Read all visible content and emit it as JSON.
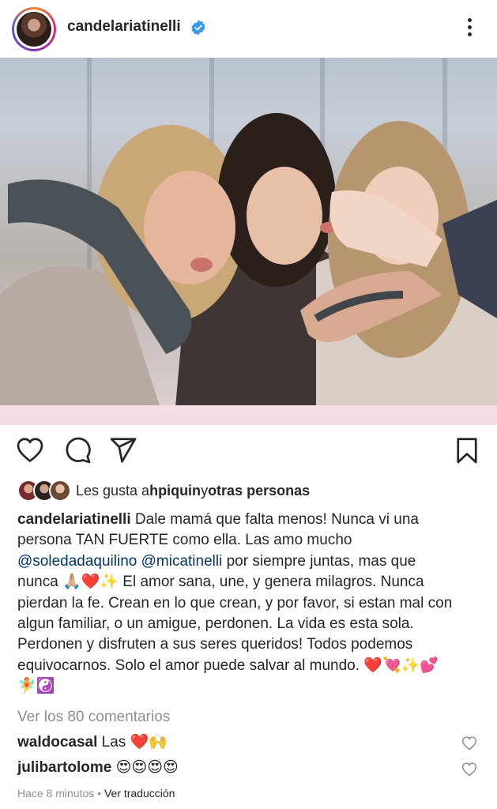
{
  "header": {
    "username": "candelariatinelli"
  },
  "likes": {
    "prefix": "Les gusta a ",
    "user": "hpiquin",
    "connector": " y ",
    "others": "otras personas"
  },
  "caption": {
    "username": "candelariatinelli",
    "line1": " Dale mamá que falta menos! Nunca vi una",
    "line2": "persona TAN FUERTE como ella. Las amo mucho",
    "mention1": "@soledadaquilino",
    "mention2": "@micatinelli",
    "line3_rest": " por siempre juntas, mas que",
    "line4a": "nunca 🙏🏼❤️✨ El amor sana, une, y genera milagros. Nunca",
    "line5": "pierdan la fe. Crean en lo que crean, y por favor, si estan mal con",
    "line6": "algun familiar, o un amigue, perdonen. La vida es esta sola.",
    "line7": "Perdonen y disfruten a sus seres queridos! Todos podemos",
    "line8": "equivocarnos. Solo el amor puede salvar al mundo. ❤️💘✨💕",
    "line9": "🧚☯️"
  },
  "comments_link": "Ver los 80 comentarios",
  "comments": [
    {
      "user": "waldocasal",
      "text": " Las ❤️🙌"
    },
    {
      "user": "julibartolome",
      "text": " 😍😍😍😍"
    }
  ],
  "meta": {
    "time": "Hace 8 minutos",
    "separator": " • ",
    "translate": "Ver traducción"
  },
  "colors": {
    "text": "#262626",
    "secondary": "#8e8e8e",
    "mention": "#00376b",
    "verified": "#3897f0"
  }
}
